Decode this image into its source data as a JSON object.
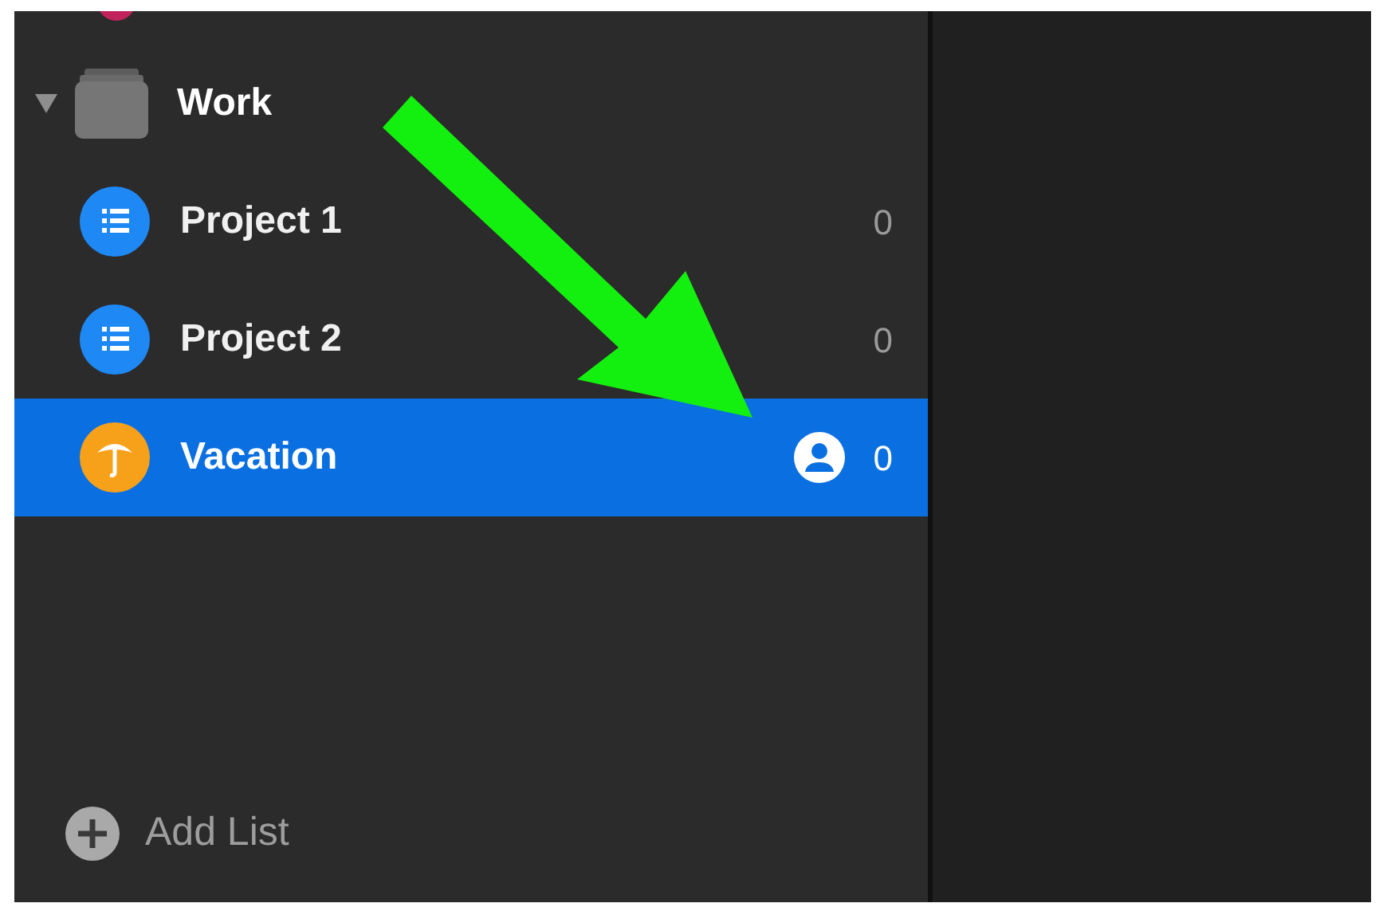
{
  "sidebar": {
    "cut_item": {
      "color": "#c0245a"
    },
    "group": {
      "label": "Work",
      "expanded": true,
      "children": [
        {
          "label": "Project 1",
          "kind": "list",
          "color": "#1e88f5",
          "count": "0",
          "selected": false,
          "shared": false
        },
        {
          "label": "Project 2",
          "kind": "list",
          "color": "#1e88f5",
          "count": "0",
          "selected": false,
          "shared": false
        },
        {
          "label": "Vacation",
          "kind": "umbrella",
          "color": "#f7a11a",
          "count": "0",
          "selected": true,
          "shared": true
        }
      ]
    },
    "add_button": {
      "label": "Add List"
    }
  },
  "annotation": {
    "kind": "arrow"
  }
}
